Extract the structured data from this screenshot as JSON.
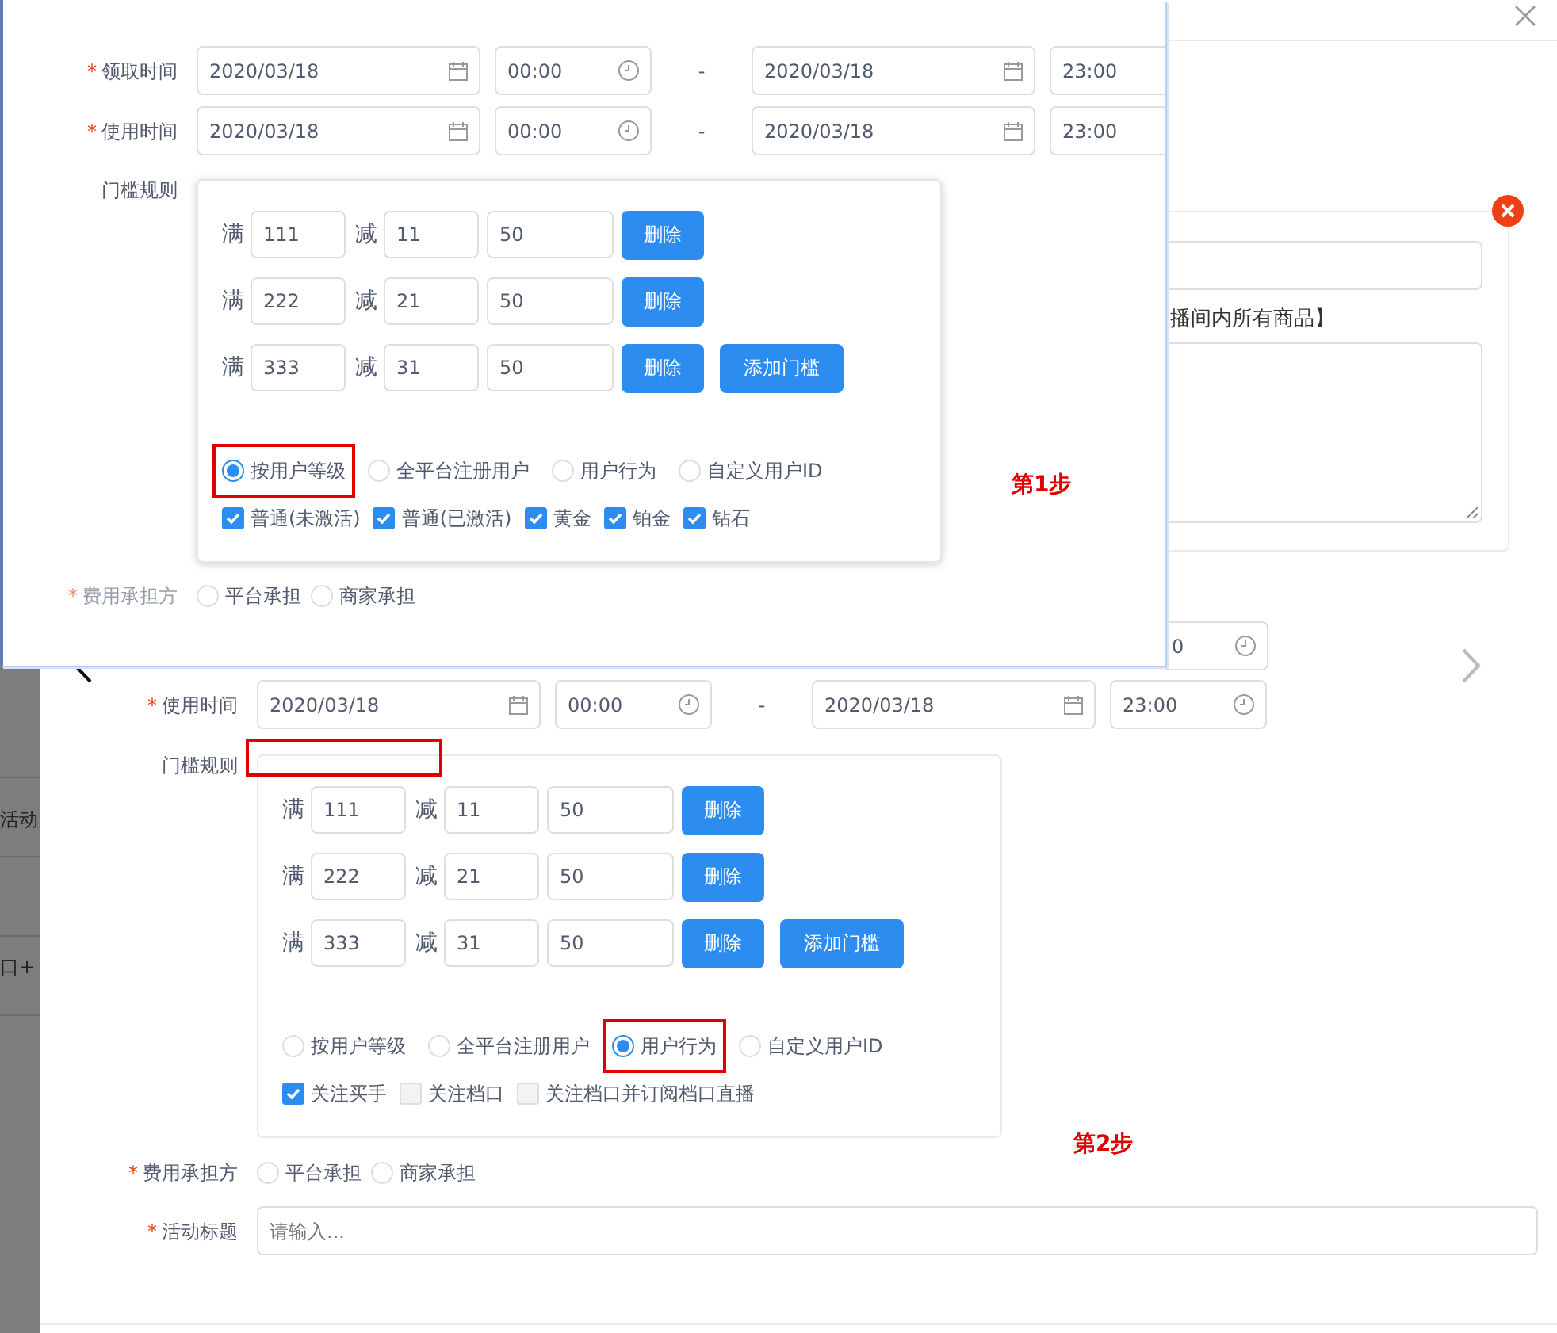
{
  "backdrop": {
    "texts": [
      "活动",
      "口+"
    ]
  },
  "dialog": {
    "side_card": {
      "note": "播间内所有商品】"
    },
    "form": {
      "partial_field": {
        "value": "0"
      },
      "use_time": {
        "label": "使用时间",
        "required_mark": "*",
        "start_date": "2020/03/18",
        "start_time": "00:00",
        "separator": "-",
        "end_date": "2020/03/18",
        "end_time": "23:00"
      },
      "threshold": {
        "label": "门槛规则",
        "annotation_box": true,
        "rules": [
          {
            "prefix": "满",
            "min": "111",
            "cut_label": "减",
            "cut": "11",
            "qty": "50",
            "delete": "删除"
          },
          {
            "prefix": "满",
            "min": "222",
            "cut_label": "减",
            "cut": "21",
            "qty": "50",
            "delete": "删除"
          },
          {
            "prefix": "满",
            "min": "333",
            "cut_label": "减",
            "cut": "31",
            "qty": "50",
            "delete": "删除"
          }
        ],
        "add_button": "添加门槛",
        "audience": [
          {
            "label": "按用户等级",
            "selected": false,
            "highlighted": false
          },
          {
            "label": "全平台注册用户",
            "selected": false,
            "highlighted": false
          },
          {
            "label": "用户行为",
            "selected": true,
            "highlighted": true
          },
          {
            "label": "自定义用户ID",
            "selected": false,
            "highlighted": false
          }
        ],
        "options": [
          {
            "label": "关注买手",
            "checked": true,
            "disabled": false
          },
          {
            "label": "关注档口",
            "checked": false,
            "disabled": true
          },
          {
            "label": "关注档口并订阅档口直播",
            "checked": false,
            "disabled": true
          }
        ]
      },
      "cost_bearer": {
        "label": "费用承担方",
        "required_mark": "*",
        "options": [
          {
            "label": "平台承担",
            "selected": false
          },
          {
            "label": "商家承担",
            "selected": false
          }
        ]
      },
      "title_field": {
        "label": "活动标题",
        "required_mark": "*",
        "placeholder": "请输入..."
      }
    },
    "step_label": "第2步"
  },
  "overlay_panel": {
    "claim_time": {
      "label": "领取时间",
      "required_mark": "*",
      "start_date": "2020/03/18",
      "start_time": "00:00",
      "separator": "-",
      "end_date": "2020/03/18",
      "end_time": "23:00"
    },
    "use_time": {
      "label": "使用时间",
      "required_mark": "*",
      "start_date": "2020/03/18",
      "start_time": "00:00",
      "separator": "-",
      "end_date": "2020/03/18",
      "end_time": "23:00"
    },
    "threshold": {
      "label": "门槛规则",
      "annotation_box": false,
      "rules": [
        {
          "prefix": "满",
          "min": "111",
          "cut_label": "减",
          "cut": "11",
          "qty": "50",
          "delete": "删除"
        },
        {
          "prefix": "满",
          "min": "222",
          "cut_label": "减",
          "cut": "21",
          "qty": "50",
          "delete": "删除"
        },
        {
          "prefix": "满",
          "min": "333",
          "cut_label": "减",
          "cut": "31",
          "qty": "50",
          "delete": "删除"
        }
      ],
      "add_button": "添加门槛",
      "audience": [
        {
          "label": "按用户等级",
          "selected": true,
          "highlighted": true
        },
        {
          "label": "全平台注册用户",
          "selected": false,
          "highlighted": false
        },
        {
          "label": "用户行为",
          "selected": false,
          "highlighted": false
        },
        {
          "label": "自定义用户ID",
          "selected": false,
          "highlighted": false
        }
      ],
      "options": [
        {
          "label": "普通(未激活)",
          "checked": true,
          "disabled": false
        },
        {
          "label": "普通(已激活)",
          "checked": true,
          "disabled": false
        },
        {
          "label": "黄金",
          "checked": true,
          "disabled": false
        },
        {
          "label": "铂金",
          "checked": true,
          "disabled": false
        },
        {
          "label": "钻石",
          "checked": true,
          "disabled": false
        }
      ]
    },
    "cost_bearer": {
      "label": "费用承担方",
      "required_mark": "*",
      "options": [
        {
          "label": "平台承担",
          "selected": false
        },
        {
          "label": "商家承担",
          "selected": false
        }
      ]
    },
    "step_label": "第1步"
  }
}
